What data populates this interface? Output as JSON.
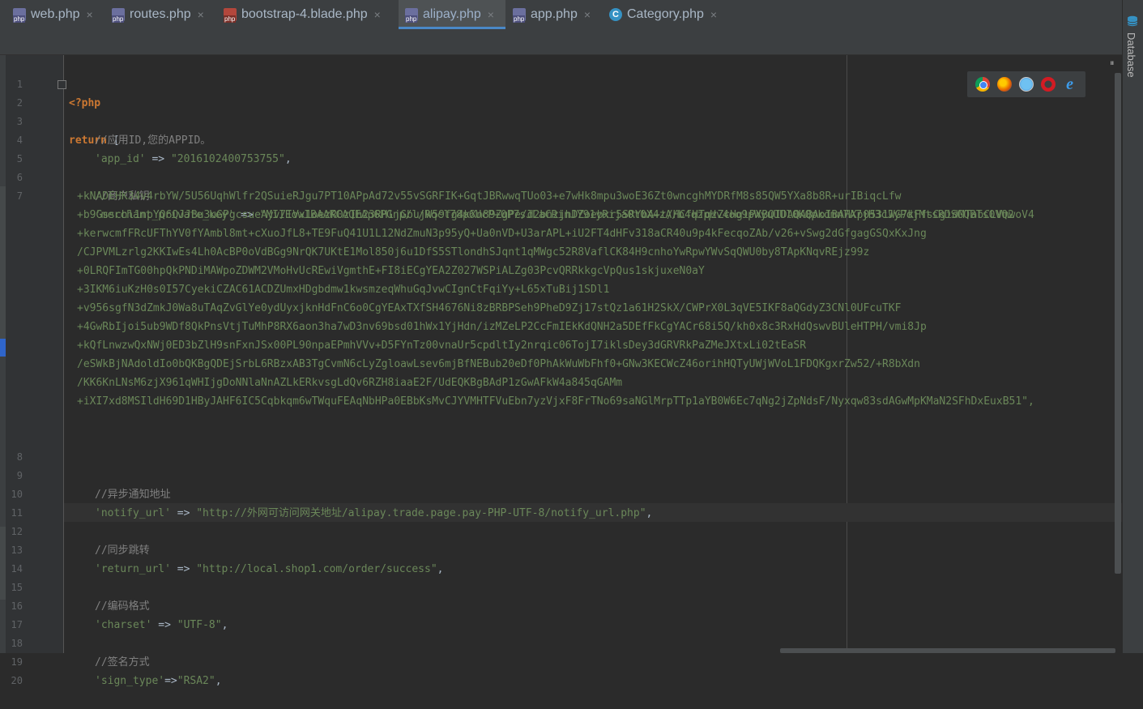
{
  "tabs": [
    {
      "label": "web.php",
      "icon": "php-file-icon",
      "active": false
    },
    {
      "label": "routes.php",
      "icon": "php-file-icon",
      "active": false
    },
    {
      "label": "bootstrap-4.blade.php",
      "icon": "blade-file-icon",
      "active": false
    },
    {
      "label": "alipay.php",
      "icon": "php-file-icon",
      "active": true
    },
    {
      "label": "app.php",
      "icon": "php-file-icon",
      "active": false
    },
    {
      "label": "Category.php",
      "icon": "class-icon",
      "active": false
    }
  ],
  "tab_close_glyph": "×",
  "class_icon_letter": "C",
  "right_panel": {
    "label": "Database",
    "icon": "database-icon"
  },
  "fold_toggle_glyph": "⏸",
  "browsers": [
    "chrome-icon",
    "firefox-icon",
    "safari-icon",
    "opera-icon",
    "ie-icon"
  ],
  "ie_glyph": "e",
  "code": {
    "l1_tag": "<?php",
    "l2_kw": "return",
    "l2_rest": " [",
    "l3": "//应用ID,您的APPID。",
    "l4_key": "'app_id'",
    "l4_arrow": " => ",
    "l4_val": "\"2016102400753755\"",
    "l4_end": ",",
    "l6": "//商户私钥",
    "l7_key": "'merchant_private_key'",
    "l7_arrow": " => ",
    "l7_val": "\"MIIEowIBAAKCAQEAp6PGnp/l/Rqcl78p6UcP+0P7sJLaCRinJY91yRija0t0X4zA/b4qzpHv4oo9pWyuUUl0KQpkdmn7A7jH3cJyPdjMtsRDSGQBTs0VQ2",
    "wrap": [
      "+kNADEHK34v4rbYW/5U56UqhWlfr2QSuieRJgu7PT10APpAd72v55vSGRFIK+GqtJBRwwqTUo03+e7wHk8mpu3woE36Zt0wncghMYDRfM8s85QW5YXa8b8R+urIBiqcLfw",
      "+b9Gsschl1npYQ6QJJBu3uGPgcsueAyv/IVx1oezR0zIh23RHljGbujW59fg4kXn89ZgPe/d2bnzjhDZoebxr5SRYbA+t/HCfHTqzZcHglPXBQIDAQABAoIBAHXp0531WG7kFfsCgidMTabCLVmwoV4",
      "+kerwcmfFRcUFThYV0fYAmbl8mt+cXuoJfL8+TE9FuQ41U1L12NdZmuN3p95yQ+Ua0nVD+U3arAPL+iU2FT4dHFv318aCR40u9p4kFecqoZAb/v26+vSwg2dGfgagGSQxKxJng",
      "/CJPVMLzrlg2KKIwEs4Lh0AcBP0oVdBGg9NrQK7UKtE1Mol850j6u1DfS5STlondhSJqnt1qMWgc52R8VaflCK84H9cnhoYwRpwYWvSqQWU0by8TApKNqvREjz99z",
      "+0LRQFImTG00hpQkPNDiMAWpoZDWM2VMoHvUcREwiVgmthE+FI8iECgYEA2Z027WSPiALZg03PcvQRRkkgcVpQus1skjuxeN0aY",
      "+3IKM6iuKzH0s0I57CyekiCZAC61ACDZUmxHDgbdmw1kwsmzeqWhuGqJvwCIgnCtFqiYy+L65xTuBij1SDl1",
      "+v956sgfN3dZmkJ0Wa8uTAqZvGlYe0ydUyxjknHdFnC6o0CgYEAxTXfSH4676Ni8zBRBPSeh9PheD9Zj17stQz1a61H2SkX/CWPrX0L3qVE5IKF8aQGdyZ3CNl0UFcuTKF",
      "+4GwRbIjoi5ub9WDf8QkPnsVtjTuMhP8RX6aon3ha7wD3nv69bsd01hWx1YjHdn/izMZeLP2CcFmIEkKdQNH2a5DEfFkCgYACr68i5Q/kh0x8c3RxHdQswvBUleHTPH/vmi8Jp",
      "+kQfLnwzwQxNWj0ED3bZlH9snFxnJSx00PL90npaEPmhVVv+D5FYnTz00vnaUr5cpdltIy2nrqic06TojI7iklsDey3dGRVRkPaZMeJXtxLi02tEaSR",
      "/eSWkBjNAdoldIo0bQKBgQDEjSrbL6RBzxAB3TgCvmN6cLyZgloawLsev6mjBfNEBub20eDf0PhAkWuWbFhf0+GNw3KECWcZ46orihHQTyUWjWVoL1FDQKgxrZw52/+R8bXdn",
      "/KK6KnLNsM6zjX961qWHIjgDoNNlaNnAZLkERkvsgLdQv6RZH8iaaE2F/UdEQKBgBAdP1zGwAFkW4a845qGAMm",
      "+iXI7xd8MSIldH69D1HByJAHF6IC5Cqbkqm6wTWquFEAqNbHPa0EBbKsMvCJYVMHTFVuEbn7yzVjxF8FrTNo69saNGlMrpTTp1aYB0W6Ec7qNg2jZpNdsF/Nyxqw83sdAGwMpKMaN2SFhDxEuxB51\","
    ],
    "l9": "//异步通知地址",
    "l10_key": "'notify_url'",
    "l10_arrow": " => ",
    "l10_val": "\"http://外网可访问网关地址/alipay.trade.page.pay-PHP-UTF-8/notify_url.php\"",
    "l10_end": ",",
    "l12": "//同步跳转",
    "l13_key": "'return_url'",
    "l13_arrow": " => ",
    "l13_val": "\"http://local.shop1.com/order/success\"",
    "l13_end": ",",
    "l15": "//编码格式",
    "l16_key": "'charset'",
    "l16_arrow": " => ",
    "l16_val": "\"UTF-8\"",
    "l16_end": ",",
    "l18": "//签名方式",
    "l19_key": "'sign_type'",
    "l19_arrow": "=>",
    "l19_val": "\"RSA2\"",
    "l19_end": ","
  },
  "line_numbers": [
    "1",
    "2",
    "3",
    "4",
    "5",
    "6",
    "7",
    "8",
    "9",
    "10",
    "11",
    "12",
    "13",
    "14",
    "15",
    "16",
    "17",
    "18",
    "19",
    "20"
  ]
}
